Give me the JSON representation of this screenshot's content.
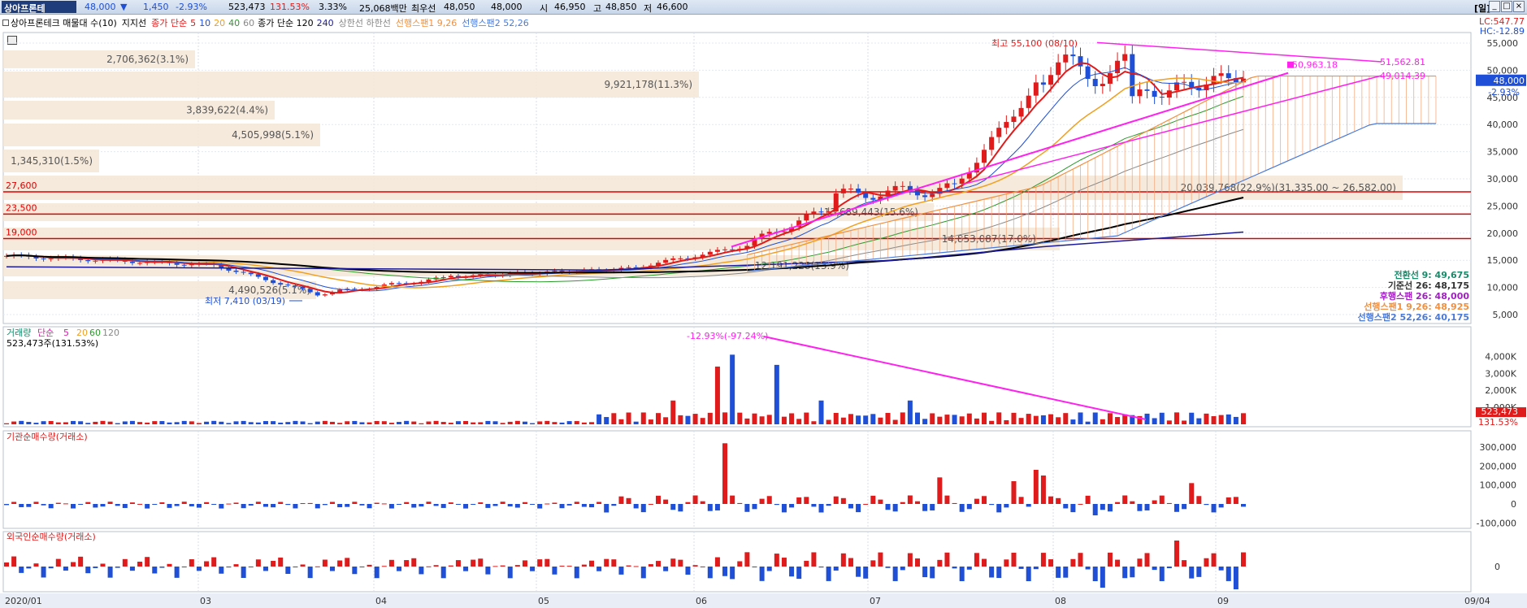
{
  "topbar": {
    "stock_name": "상아프론테",
    "price": "48,000",
    "change_arrow": "▼",
    "change": "1,450",
    "change_pct": "-2.93%",
    "volume": "523,473",
    "volume_ratio": "131.53%",
    "turnover_pct": "3.33%",
    "amount": "25,068백만",
    "best_ask_label": "최우선",
    "best_ask": "48,050",
    "best_bid": "48,000",
    "open_label": "시",
    "open": "46,950",
    "high_label": "고",
    "high": "48,850",
    "low_label": "저",
    "low": "46,600",
    "period_label": "[일]",
    "btn_min": "_",
    "btn_max": "□",
    "btn_close": "×"
  },
  "legend": {
    "title": "상아프론테크 매물대 수(10)",
    "support": "지지선",
    "ma_label": "종가 단순",
    "ma_periods": [
      "5",
      "10",
      "20",
      "40",
      "60"
    ],
    "ma2_label": "종가 단순 120",
    "ma2_period": "240",
    "upper_lower": "상한선 하한선",
    "span1": "선행스팬1 9,26",
    "span2": "선행스팬2 52,26"
  },
  "price_axis": {
    "ticks": [
      "55,000",
      "50,000",
      "45,000",
      "40,000",
      "35,000",
      "30,000",
      "25,000",
      "20,000",
      "15,000",
      "10,000",
      "5,000"
    ],
    "lc": "LC:547.77",
    "hc": "HC:-12.89",
    "current": "48,000",
    "current_pct": "-2.93%"
  },
  "volume_profile": [
    {
      "label": "2,706,362(3.1%)"
    },
    {
      "label": "9,921,178(11.3%)"
    },
    {
      "label": "3,839,622(4.4%)"
    },
    {
      "label": "4,505,998(5.1%)"
    },
    {
      "label": "1,345,310(1.5%)"
    },
    {
      "label": "20,039,768(22.9%)(31,335.00 ~ 26,582.00)"
    },
    {
      "label": "13,689,443(15.6%)"
    },
    {
      "label": "14,853,087(17.0%)"
    },
    {
      "label": "12,191,228(13.9%)"
    },
    {
      "label": "4,490,526(5.1%)"
    }
  ],
  "support_lines": [
    "27,600",
    "23,500",
    "19,000"
  ],
  "annotations": {
    "high": "최고 55,100 (08/10)",
    "low": "최저 7,410 (03/19)",
    "trend1": "50,963.18",
    "trend1b": "51,562.81",
    "trend2": "49,014.39"
  },
  "ichimoku_readout": {
    "conversion": "전환선 9: 49,675",
    "base": "기준선 26: 48,175",
    "lagging": "후행스팬 26: 48,000",
    "span1": "선행스팬1 9,26: 48,925",
    "span2": "선행스팬2 52,26: 40,175"
  },
  "volume_panel": {
    "title": "거래량",
    "ma_label": "단순",
    "ma_periods": [
      "5",
      "20",
      "60",
      "120"
    ],
    "current": "523,473주(131.53%)",
    "annotation": "-12.93%(-97.24%)",
    "ticks": [
      "4,000K",
      "3,000K",
      "2,000K",
      "1,000K"
    ],
    "current_tag": "523,473",
    "current_tag_pct": "131.53%"
  },
  "inst_panel": {
    "title": "기관순매수량(거래소)",
    "ticks": [
      "300,000",
      "200,000",
      "100,000",
      "0",
      "-100,000"
    ]
  },
  "foreign_panel": {
    "title": "외국인순매수량(거래소)",
    "ticks": [
      "0"
    ]
  },
  "date_axis": [
    "2020/01",
    "03",
    "04",
    "05",
    "06",
    "07",
    "08",
    "09",
    "09/04"
  ],
  "colors": {
    "up": "#e01b1b",
    "down": "#1e4fd6",
    "trend": "#ff22ee",
    "support": "#e00000",
    "profile": "#f5e6d6"
  }
}
